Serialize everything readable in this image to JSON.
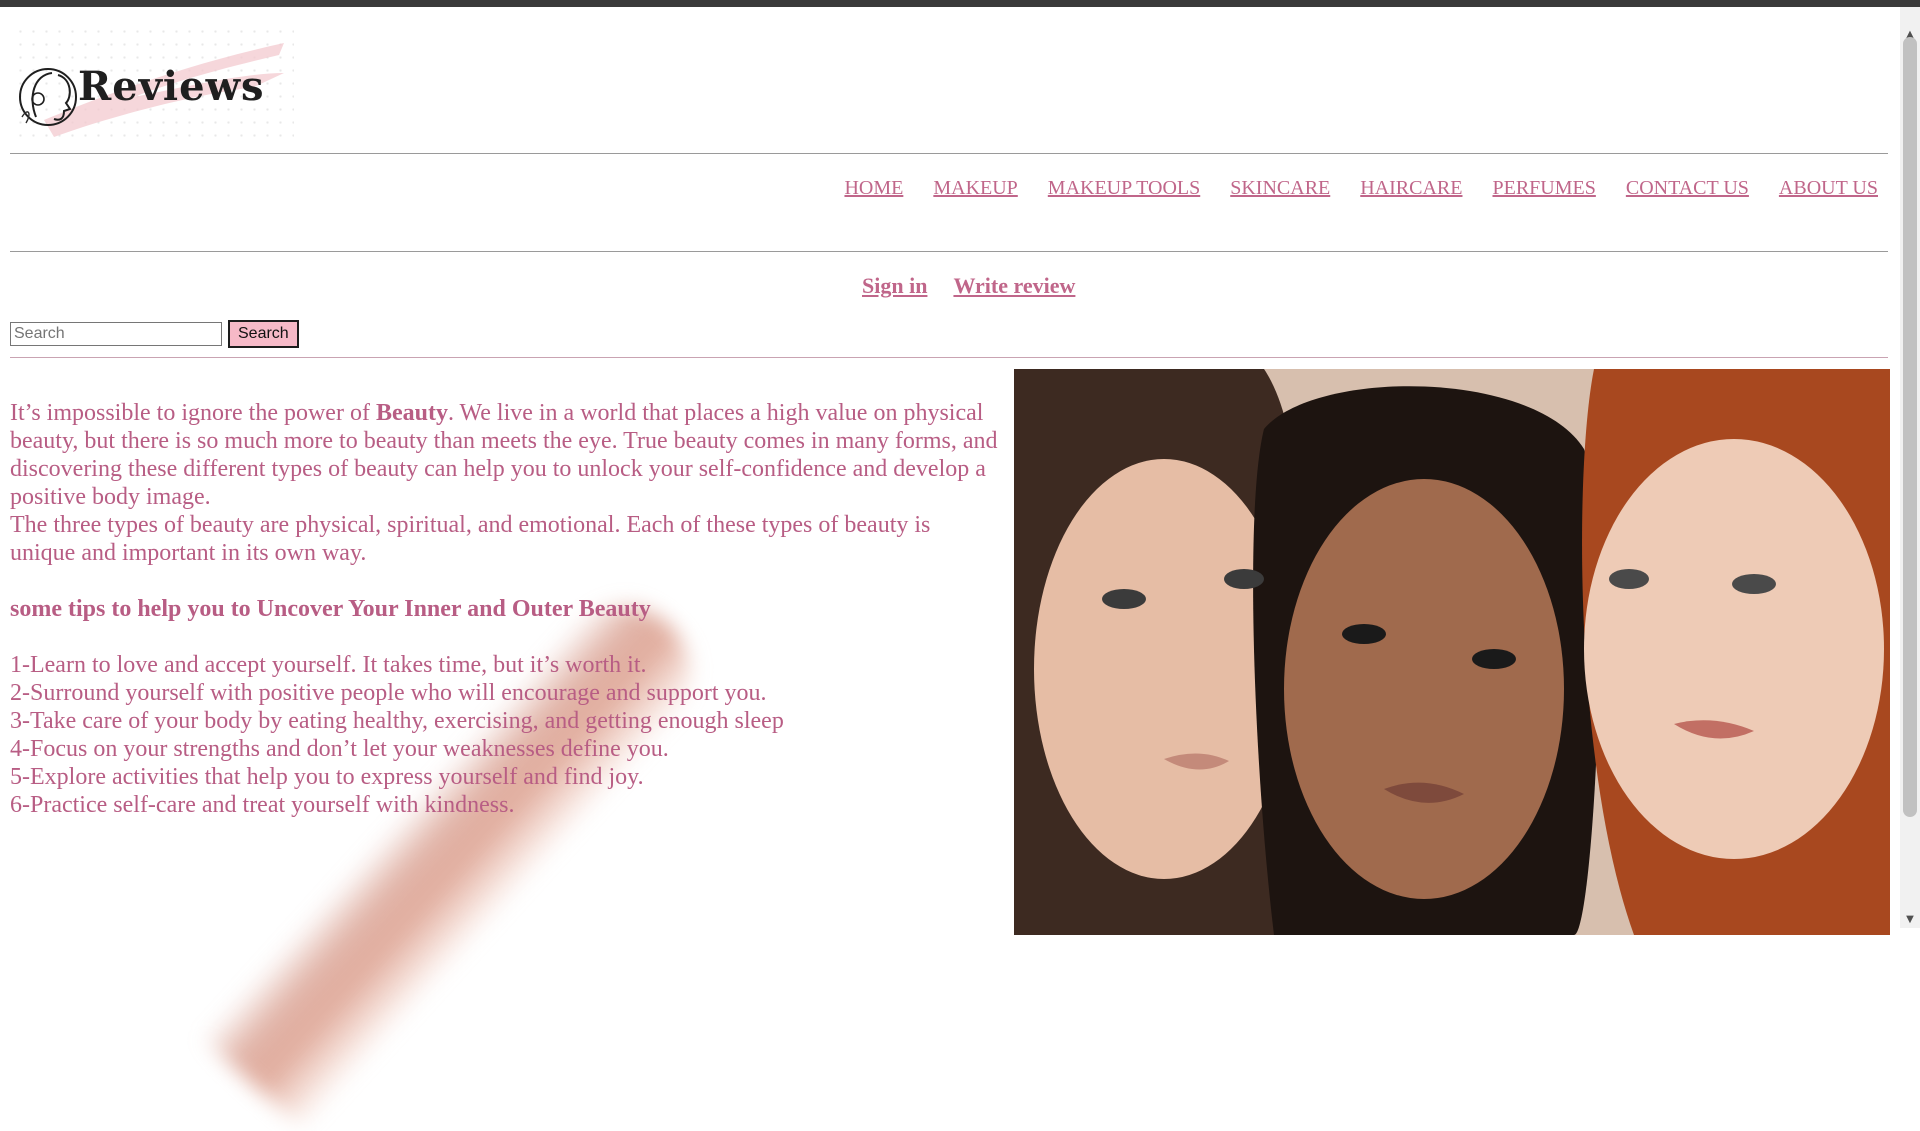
{
  "logo": {
    "text": "Reviews"
  },
  "nav": [
    "HOME",
    "MAKEUP",
    "MAKEUP TOOLS",
    "SKINCARE",
    "HAIRCARE",
    "PERFUMES",
    "CONTACT US",
    "ABOUT US"
  ],
  "auth": {
    "sign_in": "Sign in",
    "write_review": "Write review"
  },
  "search": {
    "placeholder": "Search",
    "button": "Search"
  },
  "content": {
    "intro_before": "It’s impossible to ignore the power of ",
    "intro_bold": "Beauty",
    "intro_after": ". We live in a world that places a high value on physical beauty, but there is so much more to beauty than meets the eye. True beauty comes in many forms, and discovering these different types of beauty can help you to unlock your self-confidence and develop a positive body image.",
    "types": "The three types of beauty are physical, spiritual, and emotional. Each of these types of beauty is unique and important in its own way.",
    "tips_title": "some tips to help you to Uncover Your Inner and Outer Beauty",
    "tips": [
      "1-Learn to love and accept yourself. It takes time, but it’s worth it.",
      "2-Surround yourself with positive people who will encourage and support you.",
      "3-Take care of your body by eating healthy, exercising, and getting enough sleep",
      "4-Focus on your strengths and don’t let your weaknesses define you.",
      "5-Explore activities that help you to express yourself and find joy.",
      "6-Practice self-care and treat yourself with kindness."
    ]
  },
  "colors": {
    "accent": "#c0668a",
    "text": "#b85d84",
    "button": "#f6b9c7"
  }
}
